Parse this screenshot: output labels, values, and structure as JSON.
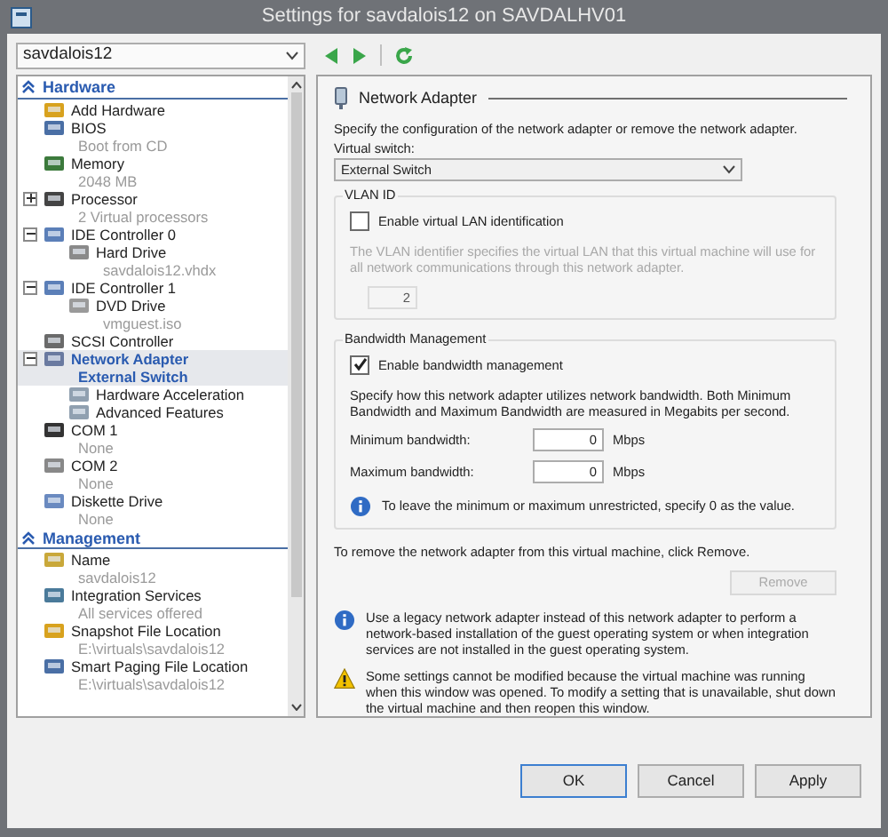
{
  "window": {
    "title": "Settings for savdalois12 on SAVDALHV01"
  },
  "vm_selector": {
    "value": "savdalois12"
  },
  "sidebar": {
    "sections": [
      {
        "title": "Hardware",
        "items": [
          {
            "label": "Add Hardware",
            "selected": false
          },
          {
            "label": "BIOS",
            "detail": "Boot from CD",
            "selected": false
          },
          {
            "label": "Memory",
            "detail": "2048 MB",
            "selected": false
          },
          {
            "label": "Processor",
            "detail": "2 Virtual processors",
            "selected": false,
            "expanded": false
          },
          {
            "label": "IDE Controller 0",
            "selected": false,
            "expanded": true,
            "children": [
              {
                "label": "Hard Drive",
                "detail": "savdalois12.vhdx",
                "selected": false
              }
            ]
          },
          {
            "label": "IDE Controller 1",
            "selected": false,
            "expanded": true,
            "children": [
              {
                "label": "DVD Drive",
                "detail": "vmguest.iso",
                "selected": false
              }
            ]
          },
          {
            "label": "SCSI Controller",
            "selected": false
          },
          {
            "label": "Network Adapter",
            "detail": "External Switch",
            "selected": true,
            "expanded": true,
            "children": [
              {
                "label": "Hardware Acceleration",
                "selected": false
              },
              {
                "label": "Advanced Features",
                "selected": false
              }
            ]
          },
          {
            "label": "COM 1",
            "detail": "None",
            "selected": false
          },
          {
            "label": "COM 2",
            "detail": "None",
            "selected": false
          },
          {
            "label": "Diskette Drive",
            "detail": "None",
            "selected": false
          }
        ]
      },
      {
        "title": "Management",
        "items": [
          {
            "label": "Name",
            "detail": "savdalois12",
            "selected": false
          },
          {
            "label": "Integration Services",
            "detail": "All services offered",
            "selected": false
          },
          {
            "label": "Snapshot File Location",
            "detail": "E:\\virtuals\\savdalois12",
            "selected": false
          },
          {
            "label": "Smart Paging File Location",
            "detail": "E:\\virtuals\\savdalois12",
            "selected": false
          }
        ]
      }
    ]
  },
  "panel": {
    "title": "Network Adapter",
    "description": "Specify the configuration of the network adapter or remove the network adapter.",
    "virtual_switch": {
      "label": "Virtual switch:",
      "value": "External Switch"
    },
    "vlan": {
      "title": "VLAN ID",
      "checkbox": {
        "label": "Enable virtual LAN identification",
        "checked": false
      },
      "help": "The VLAN identifier specifies the virtual LAN that this virtual machine will use for all network communications through this network adapter.",
      "value": "2"
    },
    "bandwidth": {
      "title": "Bandwidth Management",
      "checkbox": {
        "label": "Enable bandwidth management",
        "checked": true
      },
      "help": "Specify how this network adapter utilizes network bandwidth. Both Minimum Bandwidth and Maximum Bandwidth are measured in Megabits per second.",
      "fields": [
        {
          "label": "Minimum bandwidth:",
          "value": "0",
          "unit": "Mbps"
        },
        {
          "label": "Maximum bandwidth:",
          "value": "0",
          "unit": "Mbps"
        }
      ],
      "note": "To leave the minimum or maximum unrestricted, specify 0 as the value."
    },
    "remove_text": "To remove the network adapter from this virtual machine, click Remove.",
    "remove_button": {
      "label": "Remove",
      "disabled": true
    },
    "notes": [
      {
        "kind": "info",
        "text": "Use a legacy network adapter instead of this network adapter to perform a network-based installation of the guest operating system or when integration services are not installed in the guest operating system."
      },
      {
        "kind": "warning",
        "text": "Some settings cannot be modified because the virtual machine was running when this window was opened. To modify a setting that is unavailable, shut down the virtual machine and then reopen this window."
      }
    ]
  },
  "buttons": [
    {
      "label": "OK",
      "default": true
    },
    {
      "label": "Cancel",
      "default": false
    },
    {
      "label": "Apply",
      "default": false
    }
  ]
}
